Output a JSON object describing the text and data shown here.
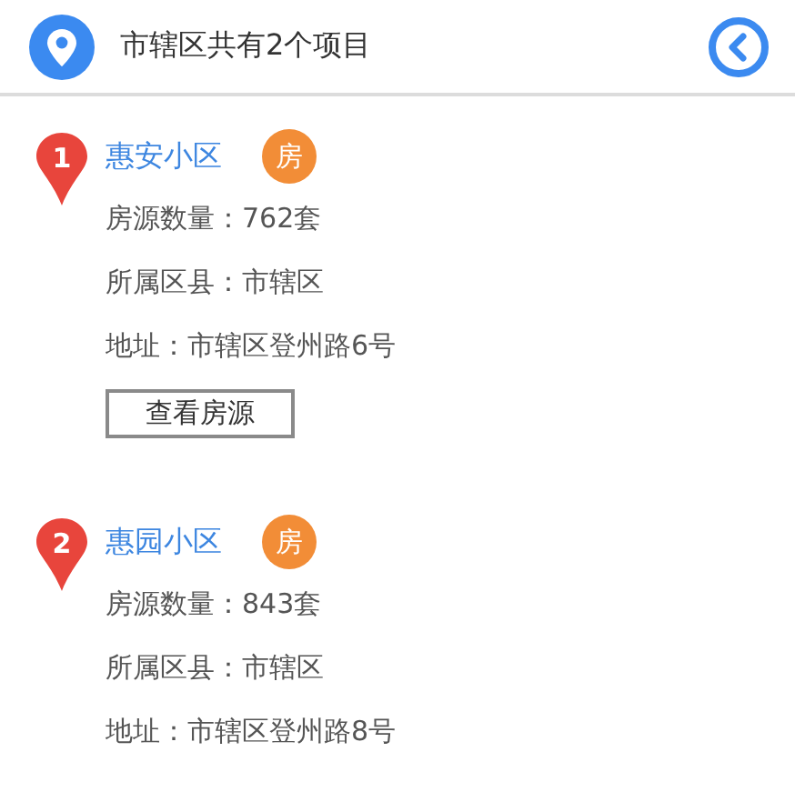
{
  "header": {
    "title": "市辖区共有2个项目"
  },
  "projects": [
    {
      "number": "1",
      "name": "惠安小区",
      "badge": "房",
      "lines": [
        "房源数量：762套",
        "所属区县：市辖区",
        "地址：市辖区登州路6号"
      ],
      "button": "查看房源"
    },
    {
      "number": "2",
      "name": "惠园小区",
      "badge": "房",
      "lines": [
        "房源数量：843套",
        "所属区县：市辖区",
        "地址：市辖区登州路8号"
      ]
    }
  ]
}
